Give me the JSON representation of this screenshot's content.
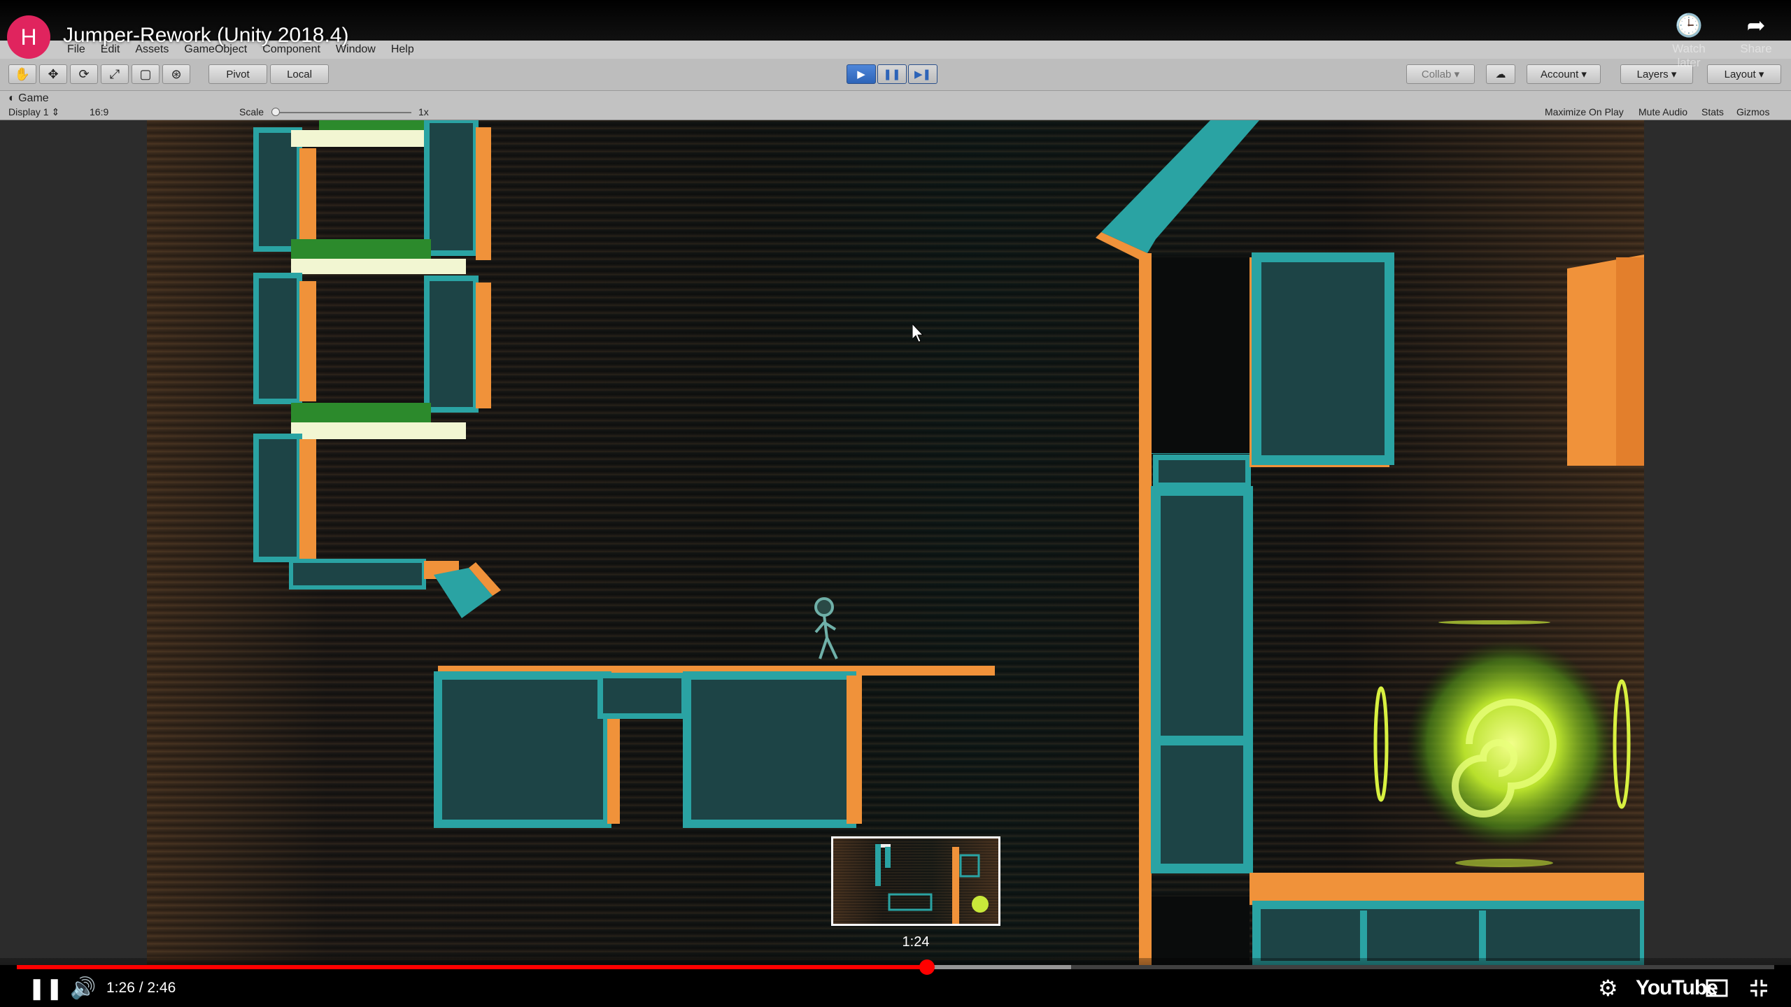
{
  "video": {
    "channel_initial": "H",
    "title": "Jumper-Rework (Unity 2018.4)",
    "watch_later_label": "Watch later",
    "share_label": "Share",
    "current_time": "1:26",
    "duration": "2:46",
    "time_display": "1:26 / 2:46",
    "preview_time": "1:24",
    "progress_fraction": 0.518,
    "buffered_fraction": 0.6,
    "logo_text": "YouTube"
  },
  "unity": {
    "menu": [
      "File",
      "Edit",
      "Assets",
      "GameObject",
      "Component",
      "Window",
      "Help"
    ],
    "pivot_label": "Pivot",
    "local_label": "Local",
    "collab_label": "Collab",
    "account_label": "Account",
    "layers_label": "Layers",
    "layout_label": "Layout",
    "game_tab": "Game",
    "display_label": "Display 1",
    "aspect_label": "16:9",
    "scale_label": "Scale",
    "scale_value": "1x",
    "maximize_label": "Maximize On Play",
    "mute_label": "Mute Audio",
    "stats_label": "Stats",
    "gizmos_label": "Gizmos"
  },
  "colors": {
    "teal": "#2aa3a3",
    "orange": "#f0923a",
    "portal": "#c8e83a",
    "youtube_red": "#ff0000"
  }
}
